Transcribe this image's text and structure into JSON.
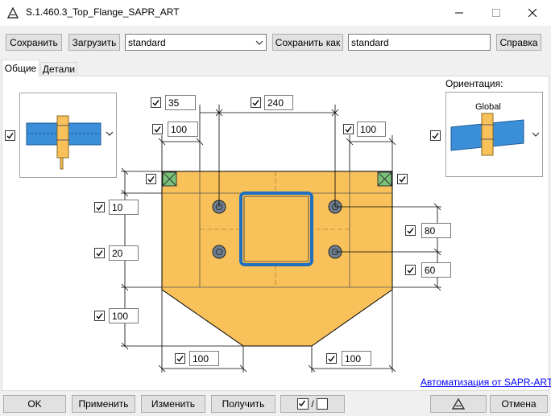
{
  "window": {
    "title": "S.1.460.3_Top_Flange_SAPR_ART"
  },
  "toolbar": {
    "save_label": "Сохранить",
    "load_label": "Загрузить",
    "preset_value": "standard",
    "save_as_label": "Сохранить как",
    "save_as_value": "standard",
    "help_label": "Справка"
  },
  "tabs": [
    {
      "label": "Общие",
      "active": true
    },
    {
      "label": "Детали",
      "active": false
    }
  ],
  "orientation": {
    "label": "Ориентация:",
    "value": "Global"
  },
  "dimensions": {
    "top_offset": "35",
    "bolt_span_x": "240",
    "left_edge": "100",
    "right_edge": "100",
    "top_edge_left": "10",
    "row_gap": "20",
    "lower_height": "100",
    "right_bolt_spacing": "80",
    "right_bottom": "60",
    "bottom_left_chamfer": "100",
    "bottom_right_chamfer": "100"
  },
  "footer": {
    "link_label": "Автоматизация от SAPR-ART",
    "ok_label": "OK",
    "apply_label": "Применить",
    "modify_label": "Изменить",
    "get_label": "Получить",
    "toggle_label": "/",
    "cancel_label": "Отмена"
  },
  "colors": {
    "plate": "#f9c15a",
    "beam": "#3a8fd8",
    "bolt": "#6f7f8f",
    "marker": "#7ac47a",
    "link": "#0000ff"
  }
}
